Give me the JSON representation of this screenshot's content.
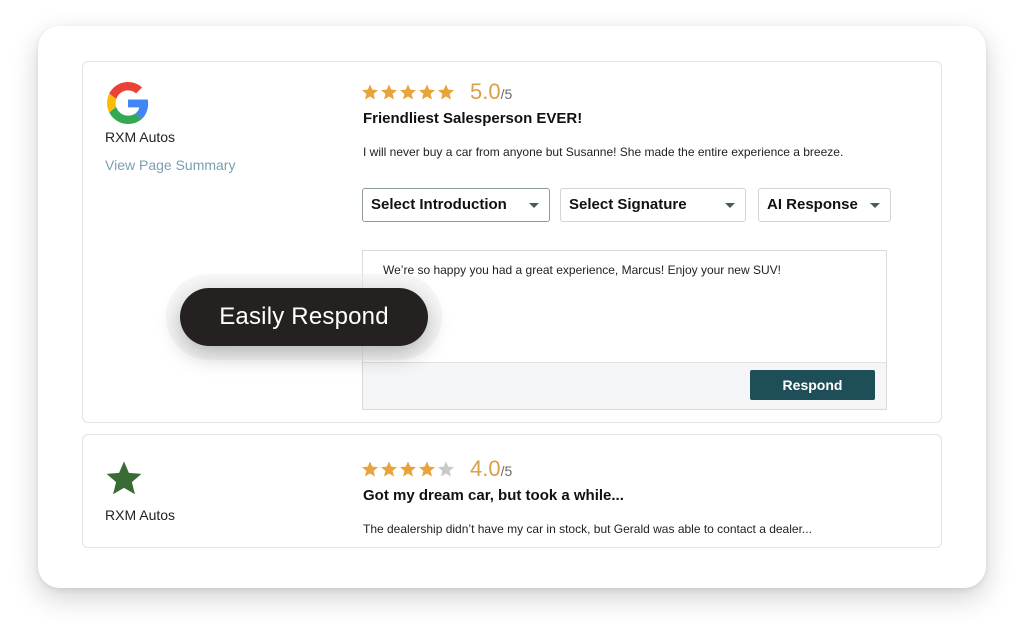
{
  "callout": {
    "label": "Easily Respond"
  },
  "reviews": [
    {
      "source_icon": "google-g-icon",
      "source_name": "RXM Autos",
      "link_label": "View Page Summary",
      "stars_filled": 5,
      "stars_total": 5,
      "rating": "5.0",
      "rating_out_of": "/5",
      "title": "Friendliest Salesperson EVER!",
      "body": "I will never buy a car from anyone but Susanne! She made the entire experience a breeze.",
      "dropdowns": {
        "introduction": "Select Introduction",
        "signature": "Select Signature",
        "ai_response": "AI Response"
      },
      "response_text": "We’re so happy you had a great experience, Marcus! Enjoy your new SUV!",
      "respond_label": "Respond"
    },
    {
      "source_icon": "green-star-icon",
      "source_name": "RXM Autos",
      "stars_filled": 4,
      "stars_total": 5,
      "rating": "4.0",
      "rating_out_of": "/5",
      "title": "Got my dream car, but took a while...",
      "body": "The dealership didn’t have my car in stock, but Gerald was able to contact a dealer..."
    }
  ],
  "colors": {
    "star_filled": "#e8a33a",
    "star_empty": "#c9c9c9",
    "rating_text": "#d9a045",
    "respond_button": "#1e4e57",
    "callout_bg": "#262121",
    "link": "#7aa0b0",
    "source_star": "#3b6b35"
  }
}
